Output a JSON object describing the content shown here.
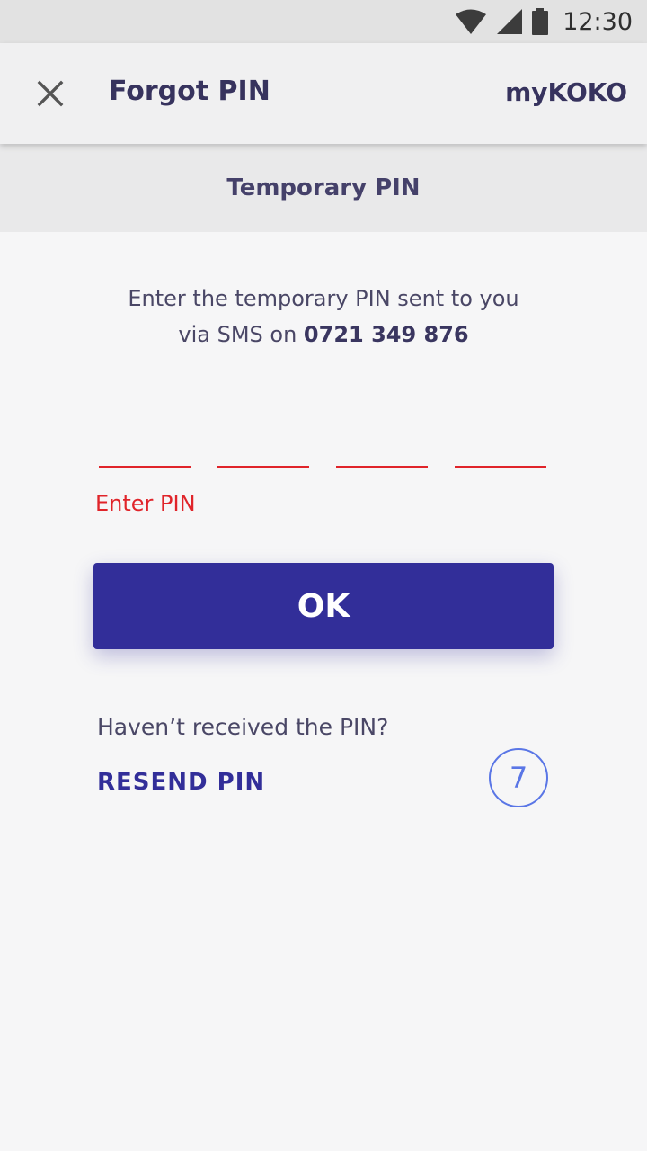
{
  "status_bar": {
    "time": "12:30",
    "icons": [
      "wifi-icon",
      "signal-icon",
      "battery-icon"
    ]
  },
  "app_bar": {
    "close_icon": "close-icon",
    "title": "Forgot PIN",
    "brand": "myKOKO"
  },
  "section": {
    "title": "Temporary PIN"
  },
  "instructions": {
    "line1": "Enter the temporary PIN sent to you",
    "line2_prefix": "via SMS on ",
    "phone": "0721 349 876"
  },
  "pin": {
    "digits": [
      "",
      "",
      "",
      ""
    ],
    "error": "Enter PIN"
  },
  "ok_button": {
    "label": "OK"
  },
  "resend": {
    "question": "Haven’t received the PIN?",
    "link_label": "RESEND PIN",
    "countdown": "7"
  },
  "colors": {
    "primary": "#322e99",
    "error": "#e0242a",
    "countdown": "#5a76e6",
    "text_dark": "#37335e"
  }
}
